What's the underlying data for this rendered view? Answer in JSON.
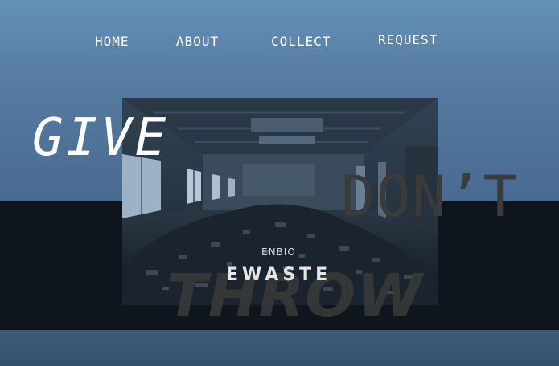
{
  "nav": {
    "items": [
      {
        "label": "HOME"
      },
      {
        "label": "ABOUT"
      },
      {
        "label": "COLLECT"
      },
      {
        "label": "REQUEST"
      }
    ]
  },
  "hero": {
    "word1": "GIVE",
    "word2": "DON’T",
    "word3": "THROW",
    "brand_small": "ENBIO",
    "brand_big": "EWASTE",
    "image": "abandoned-room-with-e-waste-pile"
  },
  "colors": {
    "background_top": "#6490b8",
    "background_bottom": "#3d5876",
    "dark_band": "#0f151d",
    "nav_text": "#ffffff",
    "ghost_text": "#3b3b3b"
  }
}
